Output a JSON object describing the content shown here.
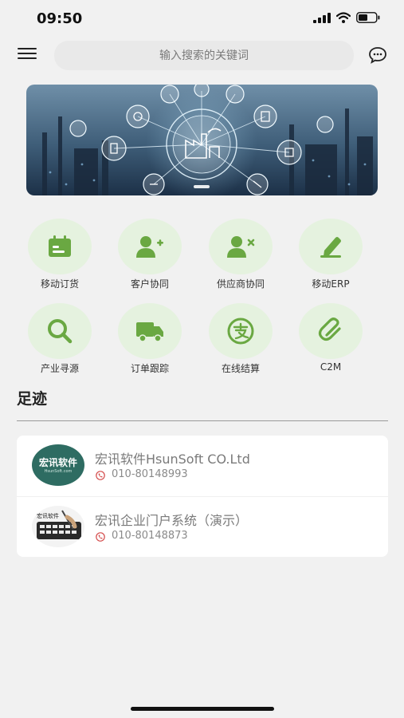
{
  "status_bar": {
    "time": "09:50"
  },
  "header": {
    "search_placeholder": "输入搜索的关键词"
  },
  "banner": {
    "active_slide": 1
  },
  "grid": {
    "items": [
      {
        "label": "移动订货",
        "icon": "calendar-icon"
      },
      {
        "label": "客户协同",
        "icon": "add-user-icon"
      },
      {
        "label": "供应商协同",
        "icon": "remove-user-icon"
      },
      {
        "label": "移动ERP",
        "icon": "edit-icon"
      },
      {
        "label": "产业寻源",
        "icon": "search-icon"
      },
      {
        "label": "订单跟踪",
        "icon": "truck-icon"
      },
      {
        "label": "在线结算",
        "icon": "alipay-icon"
      },
      {
        "label": "C2M",
        "icon": "paperclip-icon"
      }
    ],
    "icon_color": "#6aa842",
    "circle_color": "#e5f2df"
  },
  "footprint": {
    "title": "足迹",
    "rows": [
      {
        "name": "宏讯软件HsunSoft CO.Ltd",
        "phone": "010-80148993",
        "logo_text": "宏讯软件",
        "logo_subtext": "HsunSoft.com"
      },
      {
        "name": "宏讯企业门户系统（演示）",
        "phone": "010-80148873",
        "logo_text": "宏讯软件"
      }
    ]
  }
}
